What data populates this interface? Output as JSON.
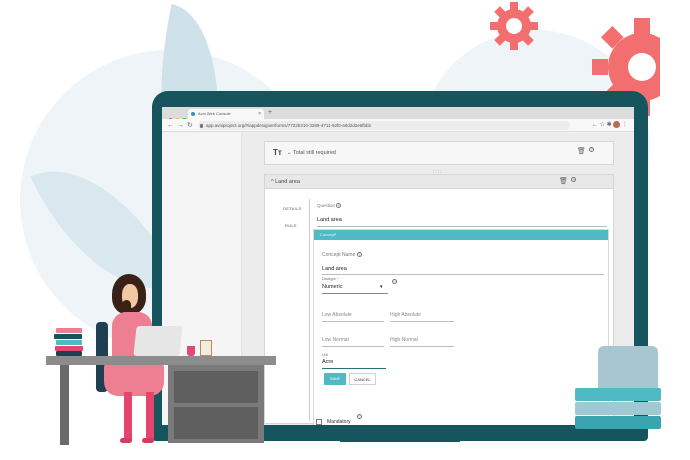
{
  "colors": {
    "teal_dark": "#16555d",
    "teal": "#4fb9c4",
    "gear": "#f36f6f",
    "pink": "#ee7e91"
  },
  "browser": {
    "tab_title": "Avni Web Console",
    "new_tab": "+",
    "url": "app.avniproject.org/#/appdesigner/forms/7722b310-3288-4711-92f0-a0d2d2e6fbbb",
    "nav": {
      "back": "←",
      "forward": "→",
      "reload": "↻"
    },
    "window_dots": [
      "#ff5f57",
      "#febc2e",
      "#28c840"
    ]
  },
  "card_total_still": {
    "type_icon": "Tт",
    "label": "⌄ Total still required"
  },
  "card_land_area": {
    "title": "^ Land area",
    "handle": "::::",
    "tabs": {
      "details": "DETAILS",
      "rule": "RULE"
    },
    "question_label": "Question",
    "question_value": "Land area",
    "concept_bar_label": "Concept*",
    "concept_name_label": "Concept Name",
    "concept_name_value": "Land area",
    "datatype_label": "Datatype *",
    "datatype_value": "Numeric",
    "low_absolute": "Low Absolute",
    "high_absolute": "High Absolute",
    "low_normal": "Low Normal",
    "high_normal": "High Normal",
    "unit_label": "Unit",
    "unit_value": "Acre",
    "save_label": "SAVE",
    "cancel_label": "CANCEL",
    "mandatory_label": "Mandatory"
  },
  "icons": {
    "delete": "🗑",
    "help": "?",
    "dropdown": "▾",
    "extensions": "✱",
    "star": "☆",
    "menu": "⋮",
    "close": "×"
  }
}
